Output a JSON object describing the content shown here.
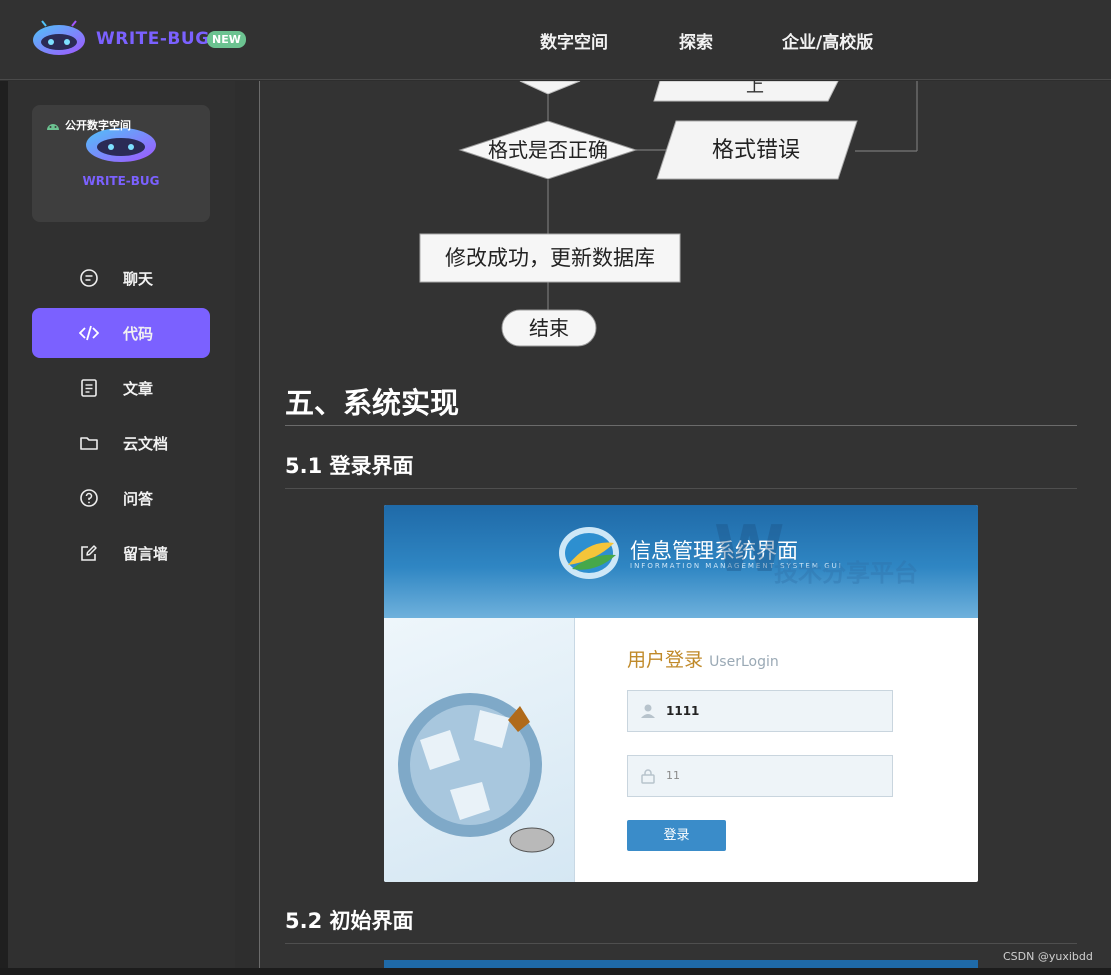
{
  "header": {
    "brand": "WRITE-BUG",
    "badge": "NEW",
    "nav": [
      "数字空间",
      "探索",
      "企业/高校版"
    ]
  },
  "sidebar": {
    "space_label": "公开数字空间",
    "space_brand": "WRITE-BUG",
    "items": [
      {
        "label": "聊天",
        "icon": "chat-icon",
        "active": false
      },
      {
        "label": "代码",
        "icon": "code-icon",
        "active": true
      },
      {
        "label": "文章",
        "icon": "article-icon",
        "active": false
      },
      {
        "label": "云文档",
        "icon": "folder-icon",
        "active": false
      },
      {
        "label": "问答",
        "icon": "question-icon",
        "active": false
      },
      {
        "label": "留言墙",
        "icon": "edit-icon",
        "active": false
      }
    ]
  },
  "flowchart": {
    "top_partial": "上",
    "decision": "格式是否正确",
    "error_box": "格式错误",
    "process": "修改成功，更新数据库",
    "end": "结束"
  },
  "article": {
    "h2": "五、系统实现",
    "h3_login": "5.1 登录界面",
    "h3_init": "5.2 初始界面"
  },
  "login_screenshot": {
    "title": "信息管理系统界面",
    "subtitle": "INFORMATION MANAGEMENT SYSTEM GUI",
    "heading": "用户登录",
    "heading_en": "UserLogin",
    "username_value": "1111",
    "password_value": "11",
    "button": "登录"
  },
  "watermark": "CSDN @yuxibdd",
  "colors": {
    "accent": "#7b61ff",
    "badge": "#6cc391",
    "background": "#333333"
  }
}
